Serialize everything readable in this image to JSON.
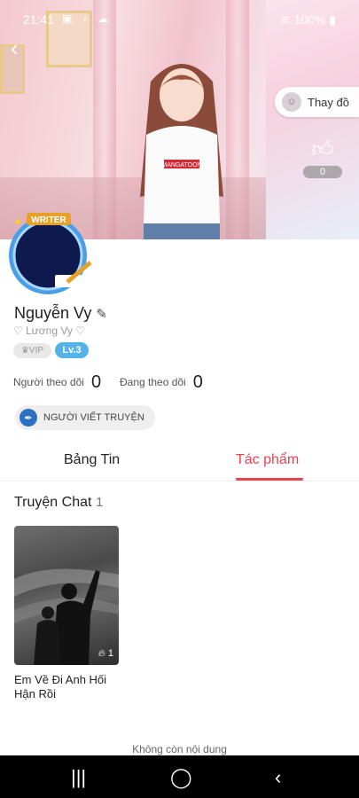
{
  "status_bar": {
    "time": "21:41",
    "left_icons": "▣ ♪ ☁",
    "battery": "100%"
  },
  "header": {
    "change_outfit_label": "Thay đồ",
    "like_count": "0"
  },
  "profile": {
    "badge_label": "WRITER",
    "name": "Nguyễn Vy",
    "subname": "♡ Lương Vy ♡",
    "vip_label": "VIP",
    "level_label": "Lv.3",
    "followers_label": "Người theo dõi",
    "followers_count": "0",
    "following_label": "Đang theo dõi",
    "following_count": "0",
    "writer_chip_label": "NGƯỜI VIẾT TRUYỆN",
    "shirt_text": "MANGATOON"
  },
  "tabs": [
    {
      "label": "Bảng Tin",
      "active": false
    },
    {
      "label": "Tác phẩm",
      "active": true
    }
  ],
  "section": {
    "title": "Truyện Chat",
    "count": "1"
  },
  "stories": [
    {
      "title": "Em Về Đi Anh Hối Hận Rồi",
      "views": "1"
    }
  ],
  "footer_text": "Không còn nội dung",
  "colors": {
    "accent": "#e8424f",
    "level": "#54b3e9"
  }
}
